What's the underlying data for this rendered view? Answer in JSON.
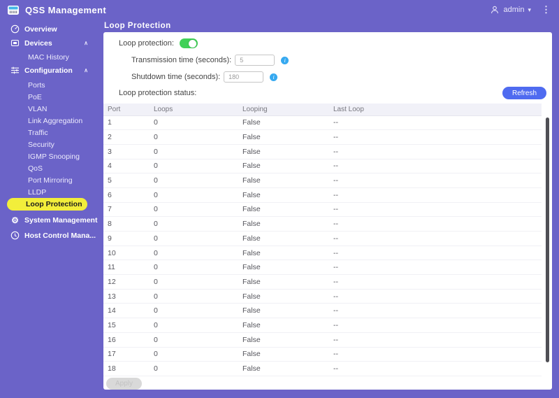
{
  "app": {
    "title": "QSS Management"
  },
  "header": {
    "user_label": "admin"
  },
  "icons": {
    "chevron_up": "∧",
    "chevron_down": "∨",
    "caret_down": "▾",
    "kebab": "⋮",
    "gear": "⚙",
    "info": "i"
  },
  "sidebar": {
    "items": [
      {
        "label": "Overview",
        "icon": "gauge-icon"
      },
      {
        "label": "Devices",
        "icon": "devices-icon",
        "chevron": "up"
      },
      {
        "label": "MAC History"
      },
      {
        "label": "Configuration",
        "icon": "sliders-icon",
        "chevron": "up"
      },
      {
        "label": "Ports"
      },
      {
        "label": "PoE"
      },
      {
        "label": "VLAN"
      },
      {
        "label": "Link Aggregation"
      },
      {
        "label": "Traffic"
      },
      {
        "label": "Security"
      },
      {
        "label": "IGMP Snooping"
      },
      {
        "label": "QoS"
      },
      {
        "label": "Port Mirroring"
      },
      {
        "label": "LLDP"
      },
      {
        "label": "Loop Protection",
        "active": true
      },
      {
        "label": "System Management",
        "icon": "gear-icon",
        "chevron": "down"
      },
      {
        "label": "Host Control Mana...",
        "icon": "host-icon"
      }
    ]
  },
  "page": {
    "title": "Loop Protection",
    "loop_protection_label": "Loop protection:",
    "toggle_state": "on",
    "transmission_label": "Transmission time (seconds):",
    "transmission_value": "5",
    "shutdown_label": "Shutdown time (seconds):",
    "shutdown_value": "180",
    "status_label": "Loop protection status:",
    "refresh_button": "Refresh",
    "apply_button": "Apply"
  },
  "table": {
    "columns": [
      "Port",
      "Loops",
      "Looping",
      "Last Loop"
    ],
    "rows": [
      [
        "1",
        "0",
        "False",
        "--"
      ],
      [
        "2",
        "0",
        "False",
        "--"
      ],
      [
        "3",
        "0",
        "False",
        "--"
      ],
      [
        "4",
        "0",
        "False",
        "--"
      ],
      [
        "5",
        "0",
        "False",
        "--"
      ],
      [
        "6",
        "0",
        "False",
        "--"
      ],
      [
        "7",
        "0",
        "False",
        "--"
      ],
      [
        "8",
        "0",
        "False",
        "--"
      ],
      [
        "9",
        "0",
        "False",
        "--"
      ],
      [
        "10",
        "0",
        "False",
        "--"
      ],
      [
        "11",
        "0",
        "False",
        "--"
      ],
      [
        "12",
        "0",
        "False",
        "--"
      ],
      [
        "13",
        "0",
        "False",
        "--"
      ],
      [
        "14",
        "0",
        "False",
        "--"
      ],
      [
        "15",
        "0",
        "False",
        "--"
      ],
      [
        "16",
        "0",
        "False",
        "--"
      ],
      [
        "17",
        "0",
        "False",
        "--"
      ],
      [
        "18",
        "0",
        "False",
        "--"
      ]
    ]
  },
  "colors": {
    "purple_bg": "#6b63c8",
    "highlight_yellow": "#f2ee3b",
    "toggle_green": "#41d158",
    "refresh_blue": "#4f6bf0",
    "info_blue": "#36a9f0",
    "table_header_bg": "#f1f1f8"
  }
}
